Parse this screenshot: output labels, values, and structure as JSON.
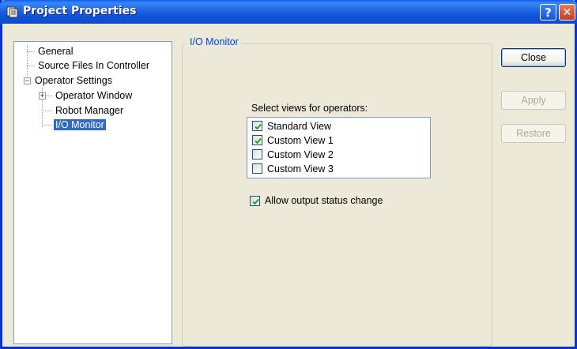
{
  "window": {
    "title": "Project Properties",
    "help_glyph": "?",
    "close_glyph": "✕"
  },
  "tree": {
    "items": [
      {
        "label": "General"
      },
      {
        "label": "Source Files In Controller"
      },
      {
        "label": "Operator Settings",
        "expander": "−"
      },
      {
        "label": "Operator Window",
        "expander": "+"
      },
      {
        "label": "Robot Manager"
      },
      {
        "label": "I/O Monitor",
        "selected": true
      }
    ]
  },
  "panel": {
    "group_title": "I/O Monitor",
    "select_label": "Select views for operators:",
    "views": [
      {
        "label": "Standard View",
        "checked": true
      },
      {
        "label": "Custom View 1",
        "checked": true
      },
      {
        "label": "Custom View 2",
        "checked": false
      },
      {
        "label": "Custom View 3",
        "checked": false
      }
    ],
    "allow_output": {
      "label": "Allow output status change",
      "checked": true
    }
  },
  "buttons": {
    "close": "Close",
    "apply": "Apply",
    "restore": "Restore"
  },
  "colors": {
    "selection": "#316AC5",
    "group_title": "#0046D5",
    "dialog_bg": "#ECE9D8",
    "title_bar": "#0B4CCB"
  }
}
